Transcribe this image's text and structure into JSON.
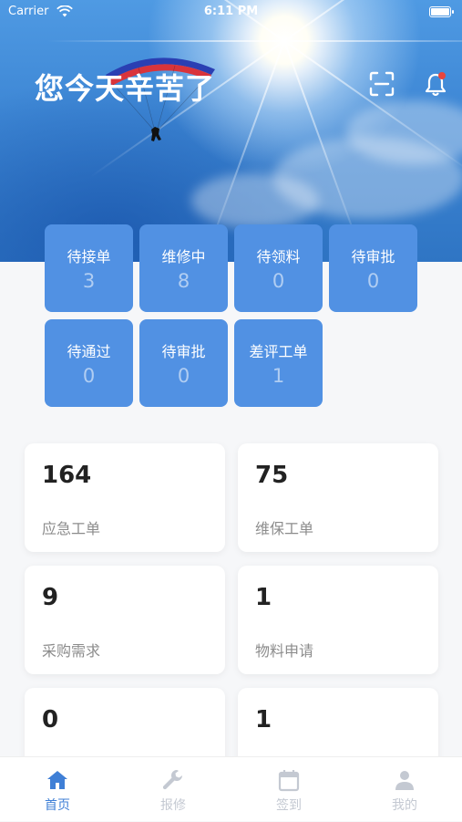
{
  "status_bar": {
    "carrier": "Carrier",
    "time": "6:11 PM"
  },
  "header": {
    "greeting": "您今天辛苦了"
  },
  "order_status_tiles": [
    {
      "label": "待接单",
      "count": "3"
    },
    {
      "label": "维修中",
      "count": "8"
    },
    {
      "label": "待领料",
      "count": "0"
    },
    {
      "label": "待审批",
      "count": "0"
    },
    {
      "label": "待通过",
      "count": "0"
    },
    {
      "label": "待审批",
      "count": "0"
    },
    {
      "label": "差评工单",
      "count": "1"
    }
  ],
  "summary_cards": [
    {
      "value": "164",
      "caption": "应急工单"
    },
    {
      "value": "75",
      "caption": "维保工单"
    },
    {
      "value": "9",
      "caption": "采购需求"
    },
    {
      "value": "1",
      "caption": "物料申请"
    },
    {
      "value": "0",
      "caption": ""
    },
    {
      "value": "1",
      "caption": ""
    }
  ],
  "tab_bar": [
    {
      "label": "首页",
      "icon": "home-icon",
      "active": true
    },
    {
      "label": "报修",
      "icon": "wrench-icon",
      "active": false
    },
    {
      "label": "签到",
      "icon": "calendar-icon",
      "active": false
    },
    {
      "label": "我的",
      "icon": "user-icon",
      "active": false
    }
  ],
  "colors": {
    "tile_bg": "#5191e3",
    "accent": "#3f7fd6",
    "notification_dot": "#e8453c"
  }
}
